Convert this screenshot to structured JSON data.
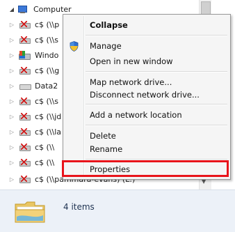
{
  "tree": {
    "root": {
      "label": "Computer"
    },
    "items": [
      {
        "label": "c$ (\\\\p",
        "icon": "network-drive-disconnected-icon"
      },
      {
        "label": "c$ (\\\\s",
        "icon": "network-drive-disconnected-icon"
      },
      {
        "label": "Windo",
        "icon": "windows-drive-icon"
      },
      {
        "label": "c$ (\\\\g",
        "icon": "network-drive-disconnected-icon"
      },
      {
        "label": "Data2",
        "icon": "drive-icon"
      },
      {
        "label": "c$ (\\\\s",
        "icon": "network-drive-disconnected-icon"
      },
      {
        "label": "c$ (\\\\jd",
        "icon": "network-drive-disconnected-icon"
      },
      {
        "label": "c$ (\\\\la",
        "icon": "network-drive-disconnected-icon"
      },
      {
        "label": "c$ (\\\\",
        "icon": "network-drive-disconnected-icon"
      },
      {
        "label": "c$ (\\\\",
        "icon": "network-drive-disconnected-icon"
      },
      {
        "label": "c$ (\\\\pammara-evans) (L:)",
        "icon": "network-drive-disconnected-icon"
      }
    ]
  },
  "context_menu": {
    "collapse": "Collapse",
    "manage": "Manage",
    "open_new_window": "Open in new window",
    "map_drive": "Map network drive...",
    "disconnect_drive": "Disconnect network drive...",
    "add_location": "Add a network location",
    "delete": "Delete",
    "rename": "Rename",
    "properties": "Properties"
  },
  "details": {
    "count": "4 items"
  },
  "colors": {
    "highlight_border": "#e8141b",
    "details_bg": "#ecf1f8"
  }
}
